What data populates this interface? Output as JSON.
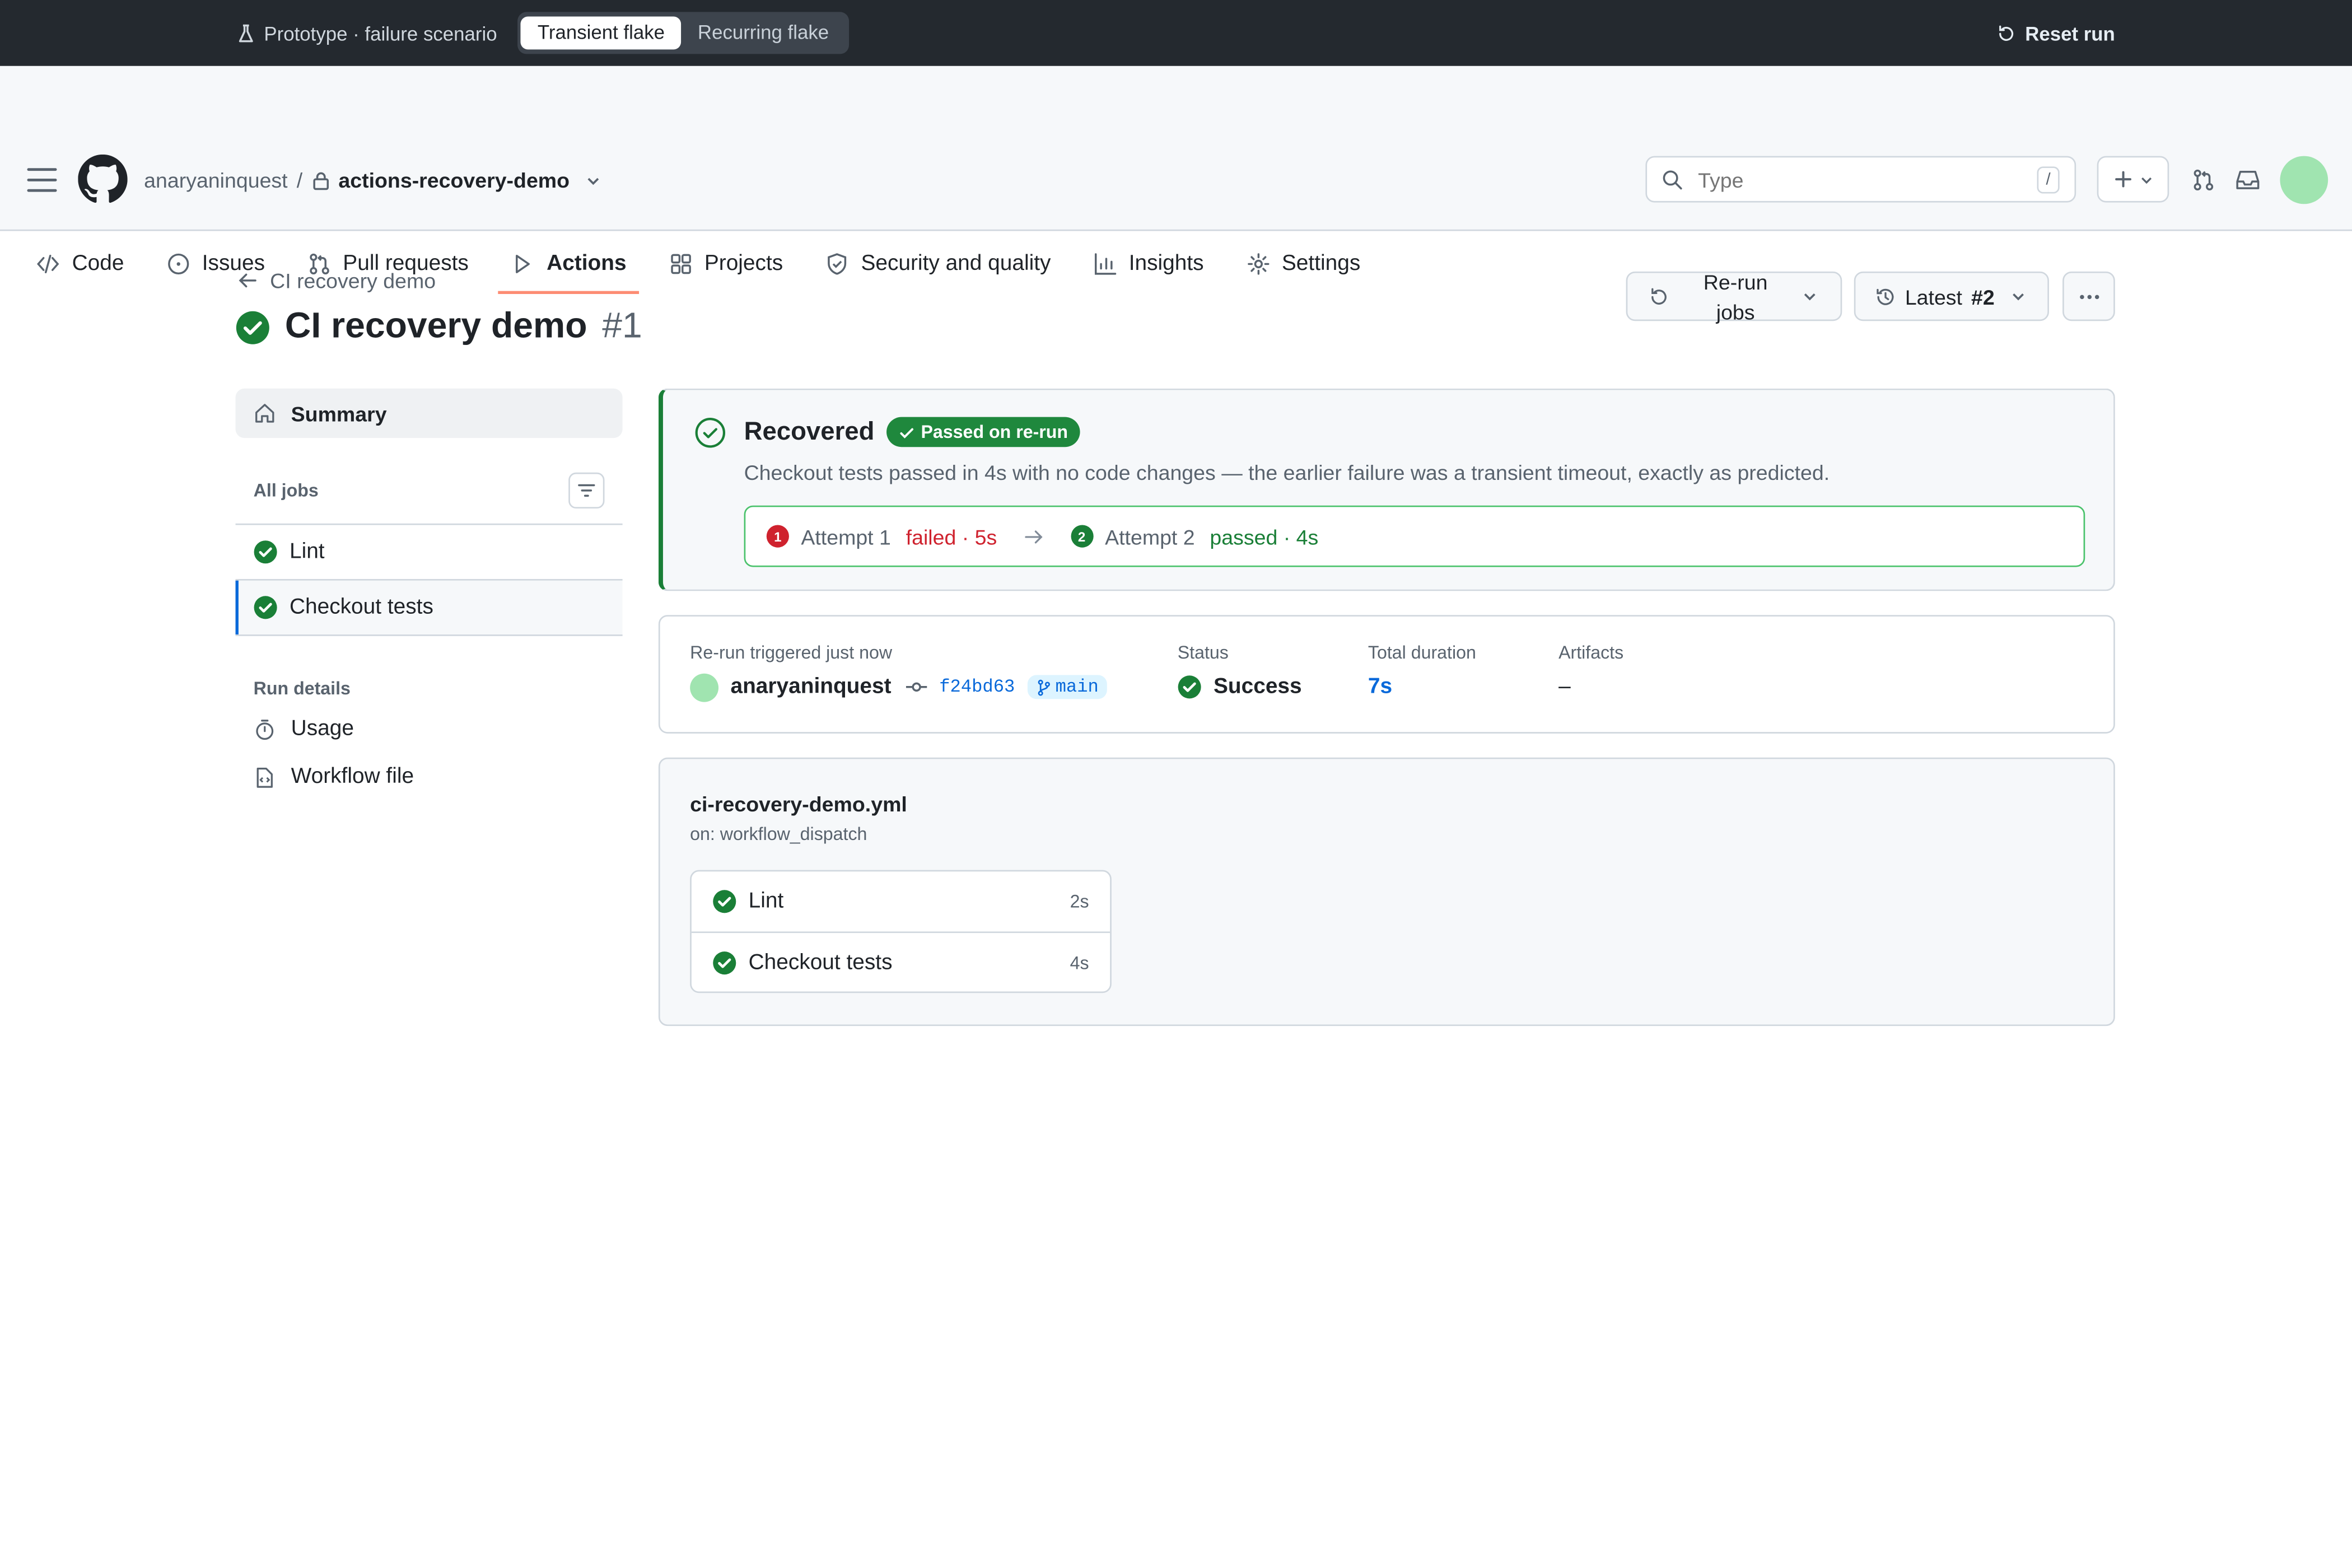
{
  "proto": {
    "label": "Prototype · failure scenario",
    "segments": [
      "Transient flake",
      "Recurring flake"
    ],
    "active_segment": "Transient flake",
    "reset": "Reset run"
  },
  "header": {
    "owner": "anaryaninquest",
    "separator": "/",
    "repo": "actions-recovery-demo",
    "search_placeholder": "Type",
    "search_shortcut": "/"
  },
  "tabs": [
    {
      "label": "Code",
      "icon": "code-icon"
    },
    {
      "label": "Issues",
      "icon": "issue-icon"
    },
    {
      "label": "Pull requests",
      "icon": "pull-request-icon"
    },
    {
      "label": "Actions",
      "icon": "play-icon",
      "active": true
    },
    {
      "label": "Projects",
      "icon": "table-icon"
    },
    {
      "label": "Security and quality",
      "icon": "shield-icon"
    },
    {
      "label": "Insights",
      "icon": "graph-icon"
    },
    {
      "label": "Settings",
      "icon": "gear-icon"
    }
  ],
  "page": {
    "back_label": "CI recovery demo",
    "title": "CI recovery demo",
    "run_number": "#1",
    "rerun_label": "Re-run jobs",
    "latest_label": "Latest",
    "latest_num": "#2"
  },
  "sidebar": {
    "summary": "Summary",
    "all_jobs": "All jobs",
    "jobs": [
      {
        "label": "Lint",
        "status": "success"
      },
      {
        "label": "Checkout tests",
        "status": "success",
        "selected": true
      }
    ],
    "run_details": "Run details",
    "links": [
      {
        "label": "Usage",
        "icon": "stopwatch-icon"
      },
      {
        "label": "Workflow file",
        "icon": "file-code-icon"
      }
    ]
  },
  "recovered": {
    "title": "Recovered",
    "badge": "Passed on re-run",
    "description": "Checkout tests passed in 4s with no code changes — the earlier failure was a transient timeout, exactly as predicted.",
    "attempt1": {
      "num": "1",
      "label": "Attempt 1",
      "result": "failed · 5s"
    },
    "attempt2": {
      "num": "2",
      "label": "Attempt 2",
      "result": "passed · 4s"
    }
  },
  "details": {
    "trigger_label": "Re-run triggered just now",
    "actor": "anaryaninquest",
    "sha": "f24bd63",
    "branch": "main",
    "status_label": "Status",
    "status_value": "Success",
    "duration_label": "Total duration",
    "duration_value": "7s",
    "artifacts_label": "Artifacts",
    "artifacts_value": "–"
  },
  "workflow": {
    "file": "ci-recovery-demo.yml",
    "trigger": "on: workflow_dispatch",
    "jobs": [
      {
        "label": "Lint",
        "time": "2s"
      },
      {
        "label": "Checkout tests",
        "time": "4s"
      }
    ]
  },
  "colors": {
    "success": "#1a7f37",
    "failure": "#cf222e",
    "accent": "#0969da",
    "tab_underline": "#fd8c73"
  }
}
